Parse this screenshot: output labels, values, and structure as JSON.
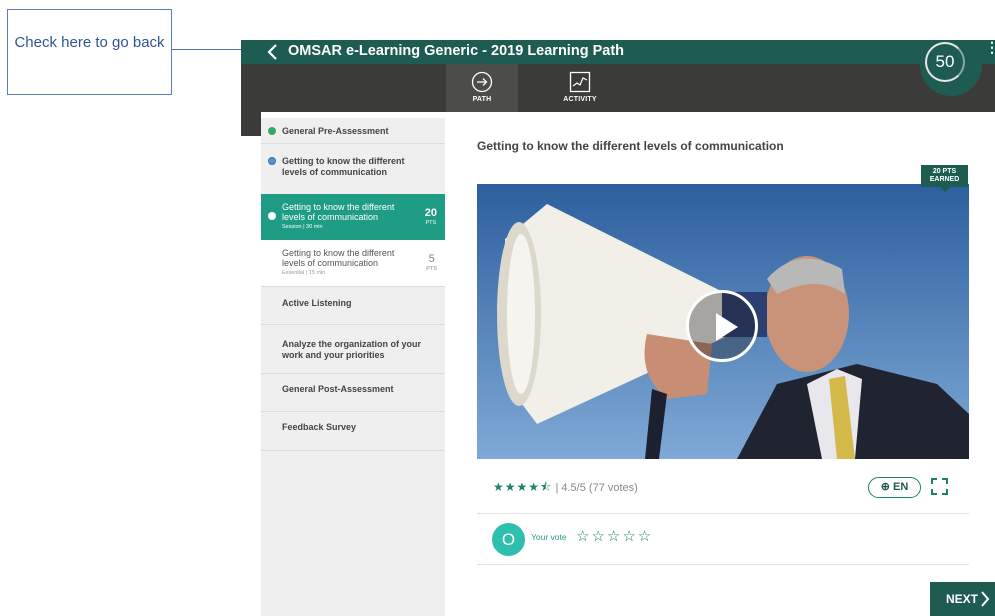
{
  "annotation": {
    "text": "Check here to go back"
  },
  "header": {
    "title": "OMSAR e-Learning Generic - 2019 Learning Path",
    "score": "50",
    "accent": "#1e5b51"
  },
  "tabs": [
    {
      "label": "PATH",
      "icon": "arrow-circle-icon",
      "active": true
    },
    {
      "label": "ACTIVITY",
      "icon": "activity-chart-icon",
      "active": false
    }
  ],
  "sidebar": {
    "items": [
      {
        "label": "General Pre-Assessment",
        "status": "completed"
      },
      {
        "label": "Getting to know the different levels of communication",
        "status": "in-progress"
      },
      {
        "label": "Active Listening"
      },
      {
        "label": "Analyze the organization of your work and your priorities"
      },
      {
        "label": "General Post-Assessment"
      },
      {
        "label": "Feedback Survey"
      }
    ],
    "subitems": [
      {
        "line1": "Getting to know the different",
        "line2": "levels of communication",
        "meta": "Session | 30 min",
        "points": "20",
        "unit": "PTS",
        "active": true
      },
      {
        "line1": "Getting to know the different",
        "line2": "levels of communication",
        "meta": "Essential | 15 min",
        "points": "5",
        "unit": "PTS",
        "active": false
      }
    ]
  },
  "main": {
    "title": "Getting to know the different levels of communication",
    "earned_line1": "20 PTS",
    "earned_line2": "EARNED",
    "rating": {
      "stars": 4.5,
      "stars_glyphs": "★★★★⯪",
      "value": "| 4.5/5",
      "votes": "(77 votes)"
    },
    "language": "EN",
    "vote": {
      "avatar_letter": "O",
      "label": "Your vote",
      "stars_glyphs": "☆☆☆☆☆"
    },
    "next_label": "NEXT"
  }
}
